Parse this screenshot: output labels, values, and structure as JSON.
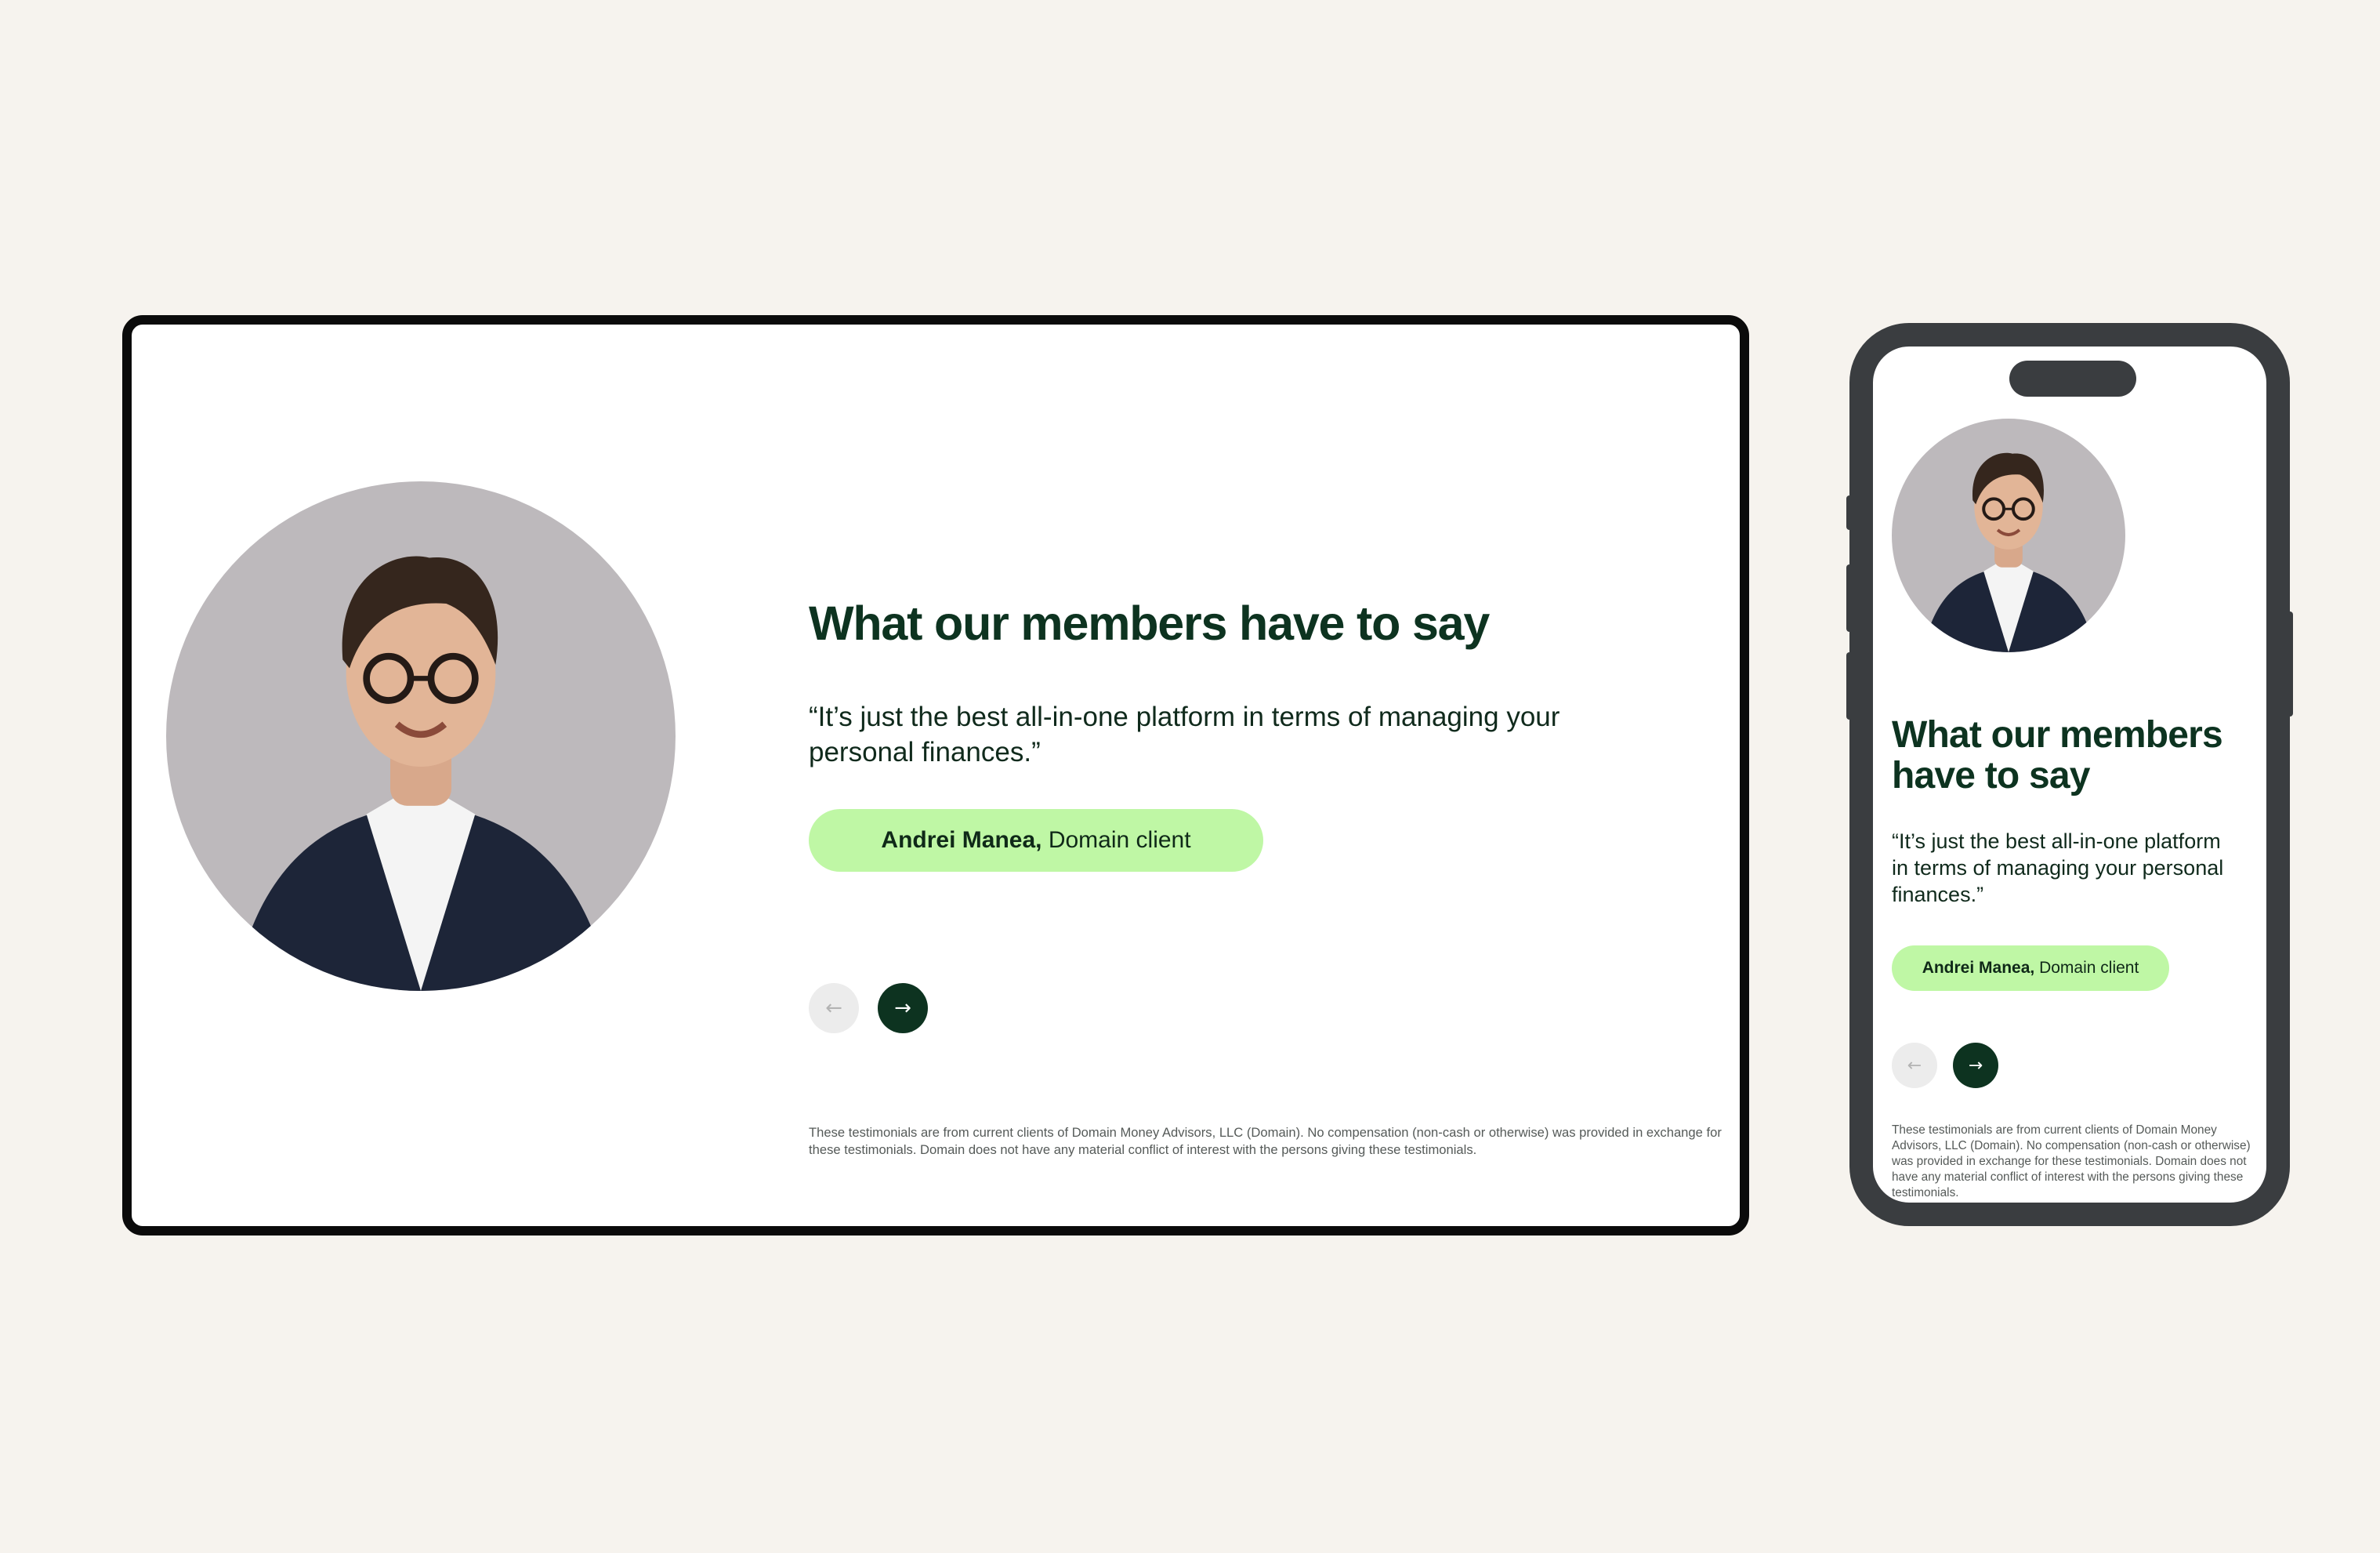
{
  "testimonial": {
    "heading": "What our members have to say",
    "quote": "“It’s just the best all-in-one platform in terms of managing your personal finances.”",
    "client_name": "Andrei Manea,",
    "client_role": "Domain client",
    "prev_icon": "←",
    "next_icon": "→",
    "disclaimer": "These testimonials are from current clients of Domain Money Advisors, LLC (Domain). No compensation (non-cash or otherwise) was provided in exchange for these testimonials. Domain does not have any material conflict of interest with the persons giving these testimonials."
  },
  "colors": {
    "page_background": "#f6f3ee",
    "heading": "#0d3320",
    "pill_background": "#bff7a5",
    "next_button": "#0d3320",
    "prev_button": "#ececec",
    "device_frame": "#3a3d40"
  },
  "icons": {
    "prev": "arrow-left-icon",
    "next": "arrow-right-icon"
  }
}
